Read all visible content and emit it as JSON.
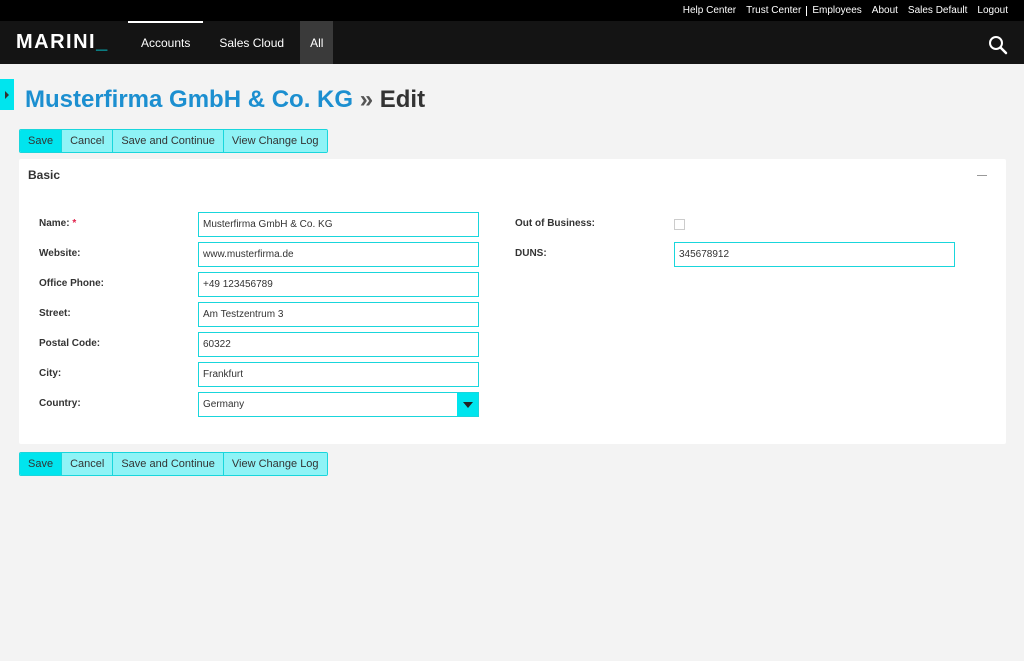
{
  "top_links": [
    "Help Center",
    "Trust Center",
    "Employees",
    "About",
    "Sales Default",
    "Logout"
  ],
  "brand": {
    "name": "MARINI",
    "underscore": "_"
  },
  "nav": {
    "accounts": "Accounts",
    "sales_cloud": "Sales Cloud",
    "all": "All"
  },
  "title": {
    "record": "Musterfirma GmbH & Co. KG",
    "separator": "»",
    "mode": "Edit"
  },
  "buttons": {
    "save": "Save",
    "cancel": "Cancel",
    "save_continue": "Save and Continue",
    "change_log": "View Change Log"
  },
  "panel": {
    "title": "Basic"
  },
  "fields": {
    "name": {
      "label": "Name:",
      "required": "*",
      "value": "Musterfirma GmbH & Co. KG"
    },
    "website": {
      "label": "Website:",
      "value": "www.musterfirma.de"
    },
    "office_phone": {
      "label": "Office Phone:",
      "value": "+49 123456789"
    },
    "street": {
      "label": "Street:",
      "value": "Am Testzentrum 3"
    },
    "postal_code": {
      "label": "Postal Code:",
      "value": "60322"
    },
    "city": {
      "label": "City:",
      "value": "Frankfurt"
    },
    "country": {
      "label": "Country:",
      "value": "Germany"
    },
    "out_of_business": {
      "label": "Out of Business:",
      "checked": false
    },
    "duns": {
      "label": "DUNS:",
      "value": "345678912"
    }
  },
  "colors": {
    "accent": "#00e5ee",
    "title_blue": "#1c8fd0",
    "required": "#e0204a",
    "nav_bg": "#141414"
  }
}
